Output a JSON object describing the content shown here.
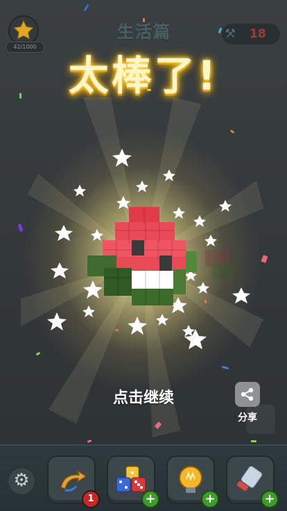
{
  "header": {
    "star_progress": "42/1000",
    "level_title": "生活篇",
    "counter_value": "18"
  },
  "celebration": {
    "headline": "太棒了!",
    "tap_hint": "点击继续"
  },
  "share": {
    "label": "分享"
  },
  "toolbar": {
    "undo_badge": "1",
    "plus_symbol": "+"
  },
  "icons": {
    "star": "star-icon",
    "counter": "hammer-icon",
    "share": "share-icon",
    "settings": "gear-icon",
    "undo": "undo-arrow-icon",
    "dice": "dice-icon",
    "bulb": "lightbulb-icon",
    "brush": "brush-icon"
  },
  "colors": {
    "headline": "#fff6c8",
    "glow": "#ffb400",
    "badge_red": "#c62828",
    "badge_green": "#3f9b2a"
  }
}
